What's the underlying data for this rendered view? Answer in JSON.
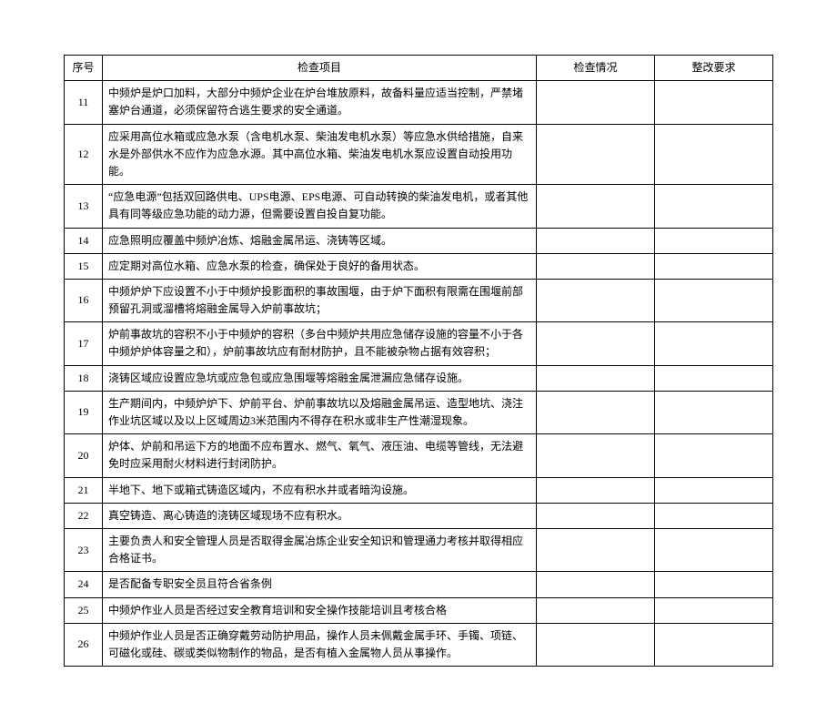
{
  "headers": {
    "seq": "序号",
    "item": "检查项目",
    "status": "检查情况",
    "req": "整改要求"
  },
  "rows": [
    {
      "seq": "11",
      "item": "中频炉是炉口加料，大部分中频炉企业在炉台堆放原料，故备料量应适当控制，严禁堵塞炉台通道，必须保留符合逃生要求的安全通道。",
      "status": "",
      "req": ""
    },
    {
      "seq": "12",
      "item": "应采用高位水箱或应急水泵（含电机水泵、柴油发电机水泵）等应急水供给措施，自来水是外部供水不应作为应急水源。其中高位水箱、柴油发电机水泵应设置自动投用功能。",
      "status": "",
      "req": ""
    },
    {
      "seq": "13",
      "item": "“应急电源”包括双回路供电、UPS电源、EPS电源、可自动转换的柴油发电机，或者其他具有同等级应急功能的动力源，但需要设置自投自复功能。",
      "status": "",
      "req": ""
    },
    {
      "seq": "14",
      "item": "应急照明应覆盖中频炉冶炼、熔融金属吊运、浇铸等区域。",
      "status": "",
      "req": ""
    },
    {
      "seq": "15",
      "item": "应定期对高位水箱、应急水泵的检查，确保处于良好的备用状态。",
      "status": "",
      "req": ""
    },
    {
      "seq": "16",
      "item": "中频炉炉下应设置不小于中频炉投影面积的事故围堰，由于炉下面积有限需在围堰前部预留孔洞或溜槽将熔融金属导入炉前事故坑；",
      "status": "",
      "req": ""
    },
    {
      "seq": "17",
      "item": "炉前事故坑的容积不小于中频炉的容积（多台中频炉共用应急储存设施的容量不小于各中频炉炉体容量之和），炉前事故坑应有耐材防护，且不能被杂物占据有效容积；",
      "status": "",
      "req": ""
    },
    {
      "seq": "18",
      "item": "浇铸区域应设置应急坑或应急包或应急围堰等熔融金属泄漏应急储存设施。",
      "status": "",
      "req": ""
    },
    {
      "seq": "19",
      "item": "生产期间内，中频炉炉下、炉前平台、炉前事故坑以及熔融金属吊运、造型地坑、浇注作业坑区域以及以上区域周边3米范围内不得存在积水或非生产性潮湿现象。",
      "status": "",
      "req": ""
    },
    {
      "seq": "20",
      "item": "炉体、炉前和吊运下方的地面不应布置水、燃气、氧气、液压油、电缆等管线，无法避免时应采用耐火材料进行封闭防护。",
      "status": "",
      "req": ""
    },
    {
      "seq": "21",
      "item": "半地下、地下或箱式铸造区域内，不应有积水井或者暗沟设施。",
      "status": "",
      "req": ""
    },
    {
      "seq": "22",
      "item": "真空铸造、离心铸造的浇铸区域现场不应有积水。",
      "status": "",
      "req": ""
    },
    {
      "seq": "23",
      "item": "主要负责人和安全管理人员是否取得金属冶炼企业安全知识和管理通力考核并取得相应合格证书。",
      "status": "",
      "req": ""
    },
    {
      "seq": "24",
      "item": "是否配备专职安全员且符合省条例",
      "status": "",
      "req": ""
    },
    {
      "seq": "25",
      "item": "中频炉作业人员是否经过安全教育培训和安全操作技能培训且考核合格",
      "status": "",
      "req": ""
    },
    {
      "seq": "26",
      "item": "中频炉作业人员是否正确穿戴劳动防护用品，操作人员未佩戴金属手环、手镯、项链、可磁化或硅、碳或类似物制作的物品，是否有植入金属物人员从事操作。",
      "status": "",
      "req": ""
    }
  ]
}
